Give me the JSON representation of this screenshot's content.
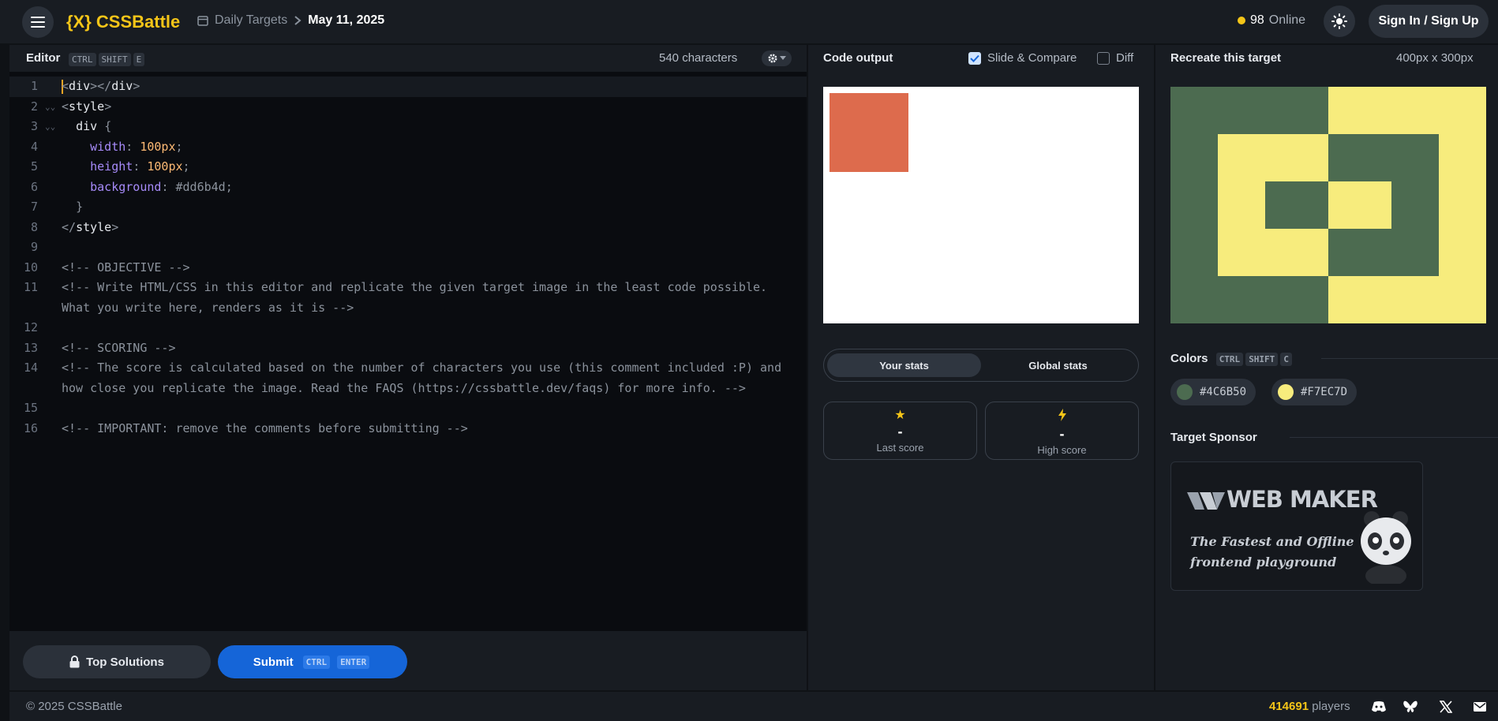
{
  "header": {
    "logo": "{X} CSSBattle",
    "breadcrumb_section": "Daily Targets",
    "breadcrumb_date": "May 11, 2025",
    "online_count": "98",
    "online_label": "Online",
    "signin_label": "Sign In / Sign Up"
  },
  "editor": {
    "title": "Editor",
    "shortcut": [
      "CTRL",
      "SHIFT",
      "E"
    ],
    "char_count": "540 characters",
    "lines": [
      {
        "n": "1",
        "text": "<div></div>"
      },
      {
        "n": "2",
        "text": "<style>"
      },
      {
        "n": "3",
        "text": "  div {"
      },
      {
        "n": "4",
        "text": "    width: 100px;"
      },
      {
        "n": "5",
        "text": "    height: 100px;"
      },
      {
        "n": "6",
        "text": "    background: #dd6b4d;"
      },
      {
        "n": "7",
        "text": "  }"
      },
      {
        "n": "8",
        "text": "</style>"
      },
      {
        "n": "9",
        "text": ""
      },
      {
        "n": "10",
        "text": "<!-- OBJECTIVE -->"
      },
      {
        "n": "11",
        "text": "<!-- Write HTML/CSS in this editor and replicate the given target image in the least code possible. What you write here, renders as it is -->"
      },
      {
        "n": "12",
        "text": ""
      },
      {
        "n": "13",
        "text": "<!-- SCORING -->"
      },
      {
        "n": "14",
        "text": "<!-- The score is calculated based on the number of characters you use (this comment included :P) and how close you replicate the image. Read the FAQS (https://cssbattle.dev/faqs) for more info. -->"
      },
      {
        "n": "15",
        "text": ""
      },
      {
        "n": "16",
        "text": "<!-- IMPORTANT: remove the comments before submitting -->"
      }
    ],
    "top_solutions_label": "Top Solutions",
    "submit_label": "Submit",
    "submit_shortcut": [
      "CTRL",
      "ENTER"
    ]
  },
  "output": {
    "title": "Code output",
    "slide_compare_label": "Slide & Compare",
    "slide_compare_checked": true,
    "diff_label": "Diff",
    "diff_checked": false,
    "square_color": "#dd6b4d",
    "tabs": [
      "Your stats",
      "Global stats"
    ],
    "active_tab": "Your stats",
    "last_score_value": "-",
    "last_score_label": "Last score",
    "high_score_value": "-",
    "high_score_label": "High score"
  },
  "target": {
    "title": "Recreate this target",
    "dimensions": "400px x 300px",
    "colors_title": "Colors",
    "colors_shortcut": [
      "CTRL",
      "SHIFT",
      "C"
    ],
    "colors": [
      "#4C6B50",
      "#F7EC7D"
    ],
    "sponsor_title": "Target Sponsor",
    "sponsor_name": "WEB MAKER",
    "sponsor_tagline": "The Fastest and Offline frontend playground"
  },
  "footer": {
    "copyright": "© 2025 CSSBattle",
    "players_count": "414691",
    "players_label": "players",
    "social": [
      "discord-icon",
      "bluesky-icon",
      "x-icon",
      "mail-icon"
    ]
  }
}
